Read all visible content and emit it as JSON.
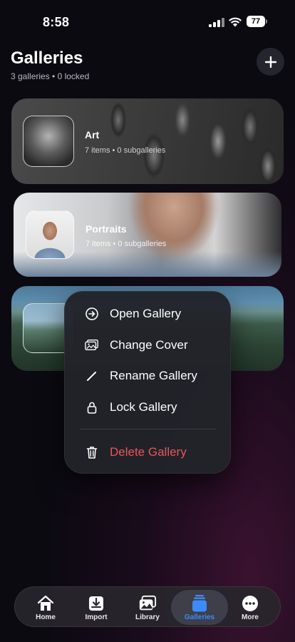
{
  "status_bar": {
    "time": "8:58",
    "battery": "77"
  },
  "header": {
    "title": "Galleries",
    "subtitle": "3 galleries • 0 locked",
    "add_icon": "plus-icon"
  },
  "galleries": [
    {
      "name": "Art",
      "meta": "7 items • 0 subgalleries"
    },
    {
      "name": "Portraits",
      "meta": "7 items • 0 subgalleries"
    },
    {
      "name": "",
      "meta": ""
    }
  ],
  "context_menu": {
    "items": [
      {
        "label": "Open Gallery",
        "icon": "arrow-circle-right-icon"
      },
      {
        "label": "Change Cover",
        "icon": "photo-stack-icon"
      },
      {
        "label": "Rename Gallery",
        "icon": "pencil-icon"
      },
      {
        "label": "Lock Gallery",
        "icon": "lock-icon"
      },
      {
        "label": "Delete Gallery",
        "icon": "trash-icon",
        "destructive": true
      }
    ],
    "destructive_color": "#e8555b"
  },
  "tab_bar": {
    "active": "Galleries",
    "active_color": "#3d8bf7",
    "tabs": [
      {
        "label": "Home",
        "icon": "house-icon"
      },
      {
        "label": "Import",
        "icon": "tray-download-icon"
      },
      {
        "label": "Library",
        "icon": "photos-icon"
      },
      {
        "label": "Galleries",
        "icon": "galleries-stack-icon"
      },
      {
        "label": "More",
        "icon": "ellipsis-circle-icon"
      }
    ]
  }
}
